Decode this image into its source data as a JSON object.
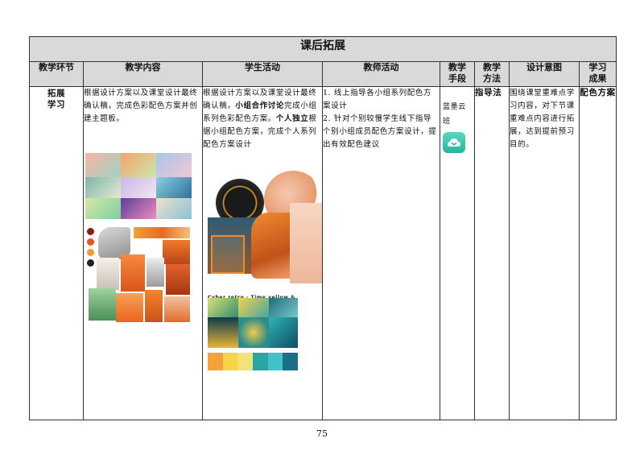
{
  "table": {
    "title": "课后拓展",
    "headers": {
      "stage": "教学环节",
      "content": "教学内容",
      "student": "学生活动",
      "teacher": "教师活动",
      "means": "教学\n手段",
      "method": "教学\n方法",
      "intent": "设计意图",
      "result": "学习\n成果"
    },
    "row": {
      "stage": "拓展\n学习",
      "content": "根据设计方案以及课堂设计最终确认稿，完成色彩配色方案并创建主题板。",
      "student_part1": "根据设计方案以及课堂设计最终确认稿，",
      "student_bold1": "小组合作讨论",
      "student_part2": "完成小组系列色彩配色方案。",
      "student_bold2": "个人独立",
      "student_part3": "根据小组配色方案，完成个人系列配色方案设计",
      "teacher": "1. 线上指导各小组系列配色方案设计\n2. 针对个别较慢学生线下指导个别小组成员配色方案设计，提出有效配色建议",
      "means": "蓝墨云班",
      "method": "指导法",
      "intent": "围绕课堂重难点学习内容，对下节课重难点内容进行拓展，达到提前预习目的。",
      "result": "配色方案"
    }
  },
  "icons": {
    "means_icon": "cloud-class-app-icon"
  },
  "collage_caption": "Cyber retro · Time yellow & Turquoise",
  "palette": [
    "#f2a33a",
    "#f7d44a",
    "#f3e27a",
    "#2aa6a0",
    "#42c2c9",
    "#1b6f86"
  ],
  "page_number": "75"
}
